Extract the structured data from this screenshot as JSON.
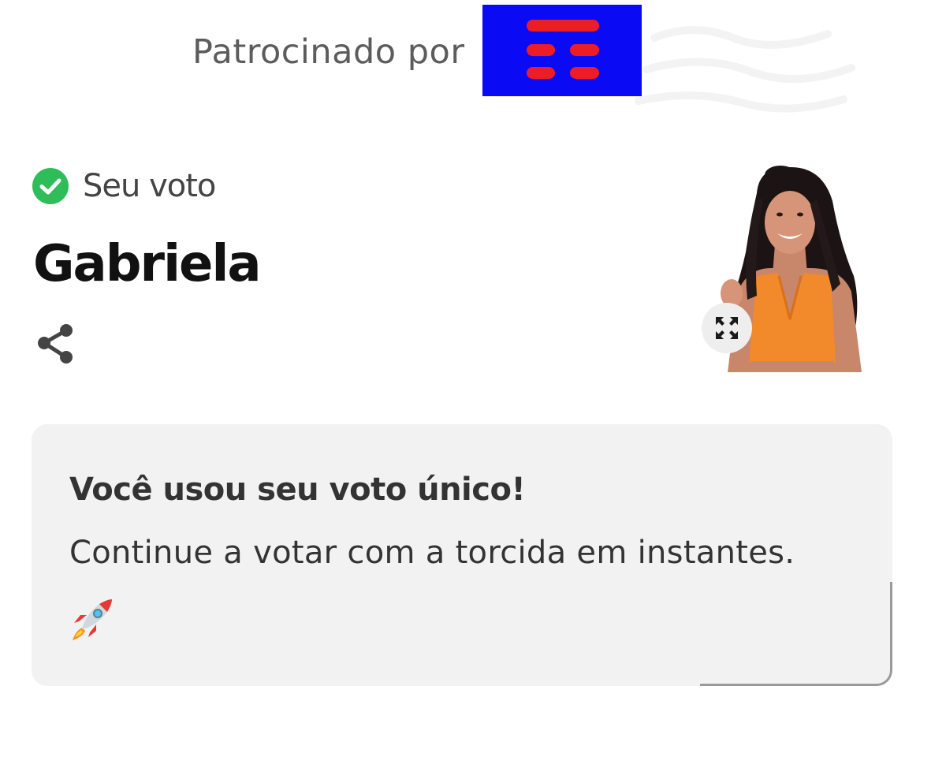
{
  "sponsor": {
    "label": "Patrocinado por",
    "logo_icon": "tim-logo-icon",
    "logo_colors": {
      "background": "#0a0af5",
      "bars": "#ee1c25"
    }
  },
  "vote": {
    "status_icon": "check-circle-icon",
    "status_color": "#2ebd59",
    "status_label": "Seu voto",
    "candidate_name": "Gabriela",
    "share_icon": "share-icon",
    "expand_icon": "expand-icon"
  },
  "card": {
    "title": "Você usou seu voto único!",
    "message": "Continue a votar com a torcida em instantes.",
    "emoji_icon": "rocket-icon"
  }
}
